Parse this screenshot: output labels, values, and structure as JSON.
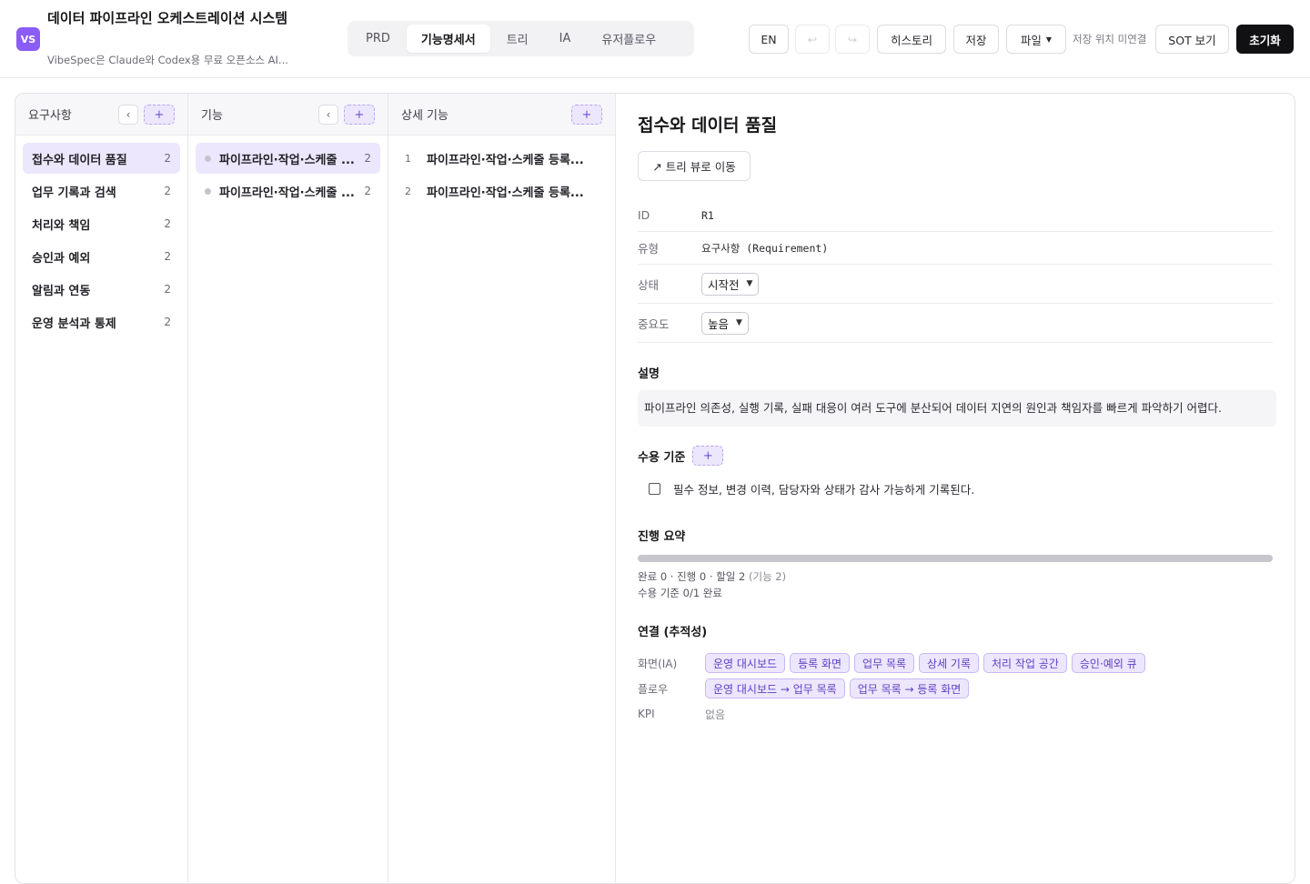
{
  "header": {
    "logo": "VS",
    "title": "데이터 파이프라인 오케스트레이션 시스템",
    "subtitle": "VibeSpec은 Claude와 Codex용 무료 오픈소스 AI...",
    "tabs": [
      "PRD",
      "기능명세서",
      "트리",
      "IA",
      "유저플로우"
    ],
    "active_tab": "기능명세서",
    "lang": "EN",
    "undo_icon": "undo-icon",
    "redo_icon": "redo-icon",
    "history": "히스토리",
    "save": "저장",
    "file": "파일",
    "save_location": "저장 위치 미연결",
    "sot": "SOT 보기",
    "reset": "초기화"
  },
  "columns": {
    "requirements": {
      "title": "요구사항",
      "collapse": "‹",
      "add": "+",
      "items": [
        {
          "label": "접수와 데이터 품질",
          "count": "2"
        },
        {
          "label": "업무 기록과 검색",
          "count": "2"
        },
        {
          "label": "처리와 책임",
          "count": "2"
        },
        {
          "label": "승인과 예외",
          "count": "2"
        },
        {
          "label": "알림과 연동",
          "count": "2"
        },
        {
          "label": "운영 분석과 통제",
          "count": "2"
        }
      ]
    },
    "features": {
      "title": "기능",
      "collapse": "‹",
      "add": "+",
      "items": [
        {
          "label": "파이프라인·작업·스케줄 ...",
          "count": "2"
        },
        {
          "label": "파이프라인·작업·스케줄 ...",
          "count": "2"
        }
      ]
    },
    "details": {
      "title": "상세 기능",
      "add": "+",
      "items": [
        {
          "num": "1",
          "label": "파이프라인·작업·스케줄 등록..."
        },
        {
          "num": "2",
          "label": "파이프라인·작업·스케줄 등록..."
        }
      ]
    }
  },
  "detail": {
    "title": "접수와 데이터 품질",
    "tree_button": "↗ 트리 뷰로 이동",
    "meta": {
      "id_label": "ID",
      "id_value": "R1",
      "type_label": "유형",
      "type_value": "요구사항 (Requirement)",
      "status_label": "상태",
      "status_value": "시작전",
      "priority_label": "중요도",
      "priority_value": "높음"
    },
    "description_title": "설명",
    "description": "파이프라인 의존성, 실행 기록, 실패 대응이 여러 도구에 분산되어 데이터 지연의 원인과 책임자를 빠르게 파악하기 어렵다.",
    "acceptance_title": "수용 기준",
    "acceptance_add": "+",
    "acceptance_items": [
      "필수 정보, 변경 이력, 담당자와 상태가 감사 가능하게 기록된다."
    ],
    "progress_title": "진행 요약",
    "progress_fraction": 0,
    "progress_line1": "완료 0 · 진행 0 · 할일 2",
    "progress_line1_muted": "(기능 2)",
    "progress_line2": "수용 기준 0/1 완료",
    "links_title": "연결 (추적성)",
    "links": {
      "ia_label": "화면(IA)",
      "ia": [
        "운영 대시보드",
        "등록 화면",
        "업무 목록",
        "상세 기록",
        "처리 작업 공간",
        "승인·예외 큐"
      ],
      "flow_label": "플로우",
      "flow": [
        "운영 대시보드 → 업무 목록",
        "업무 목록 → 등록 화면"
      ],
      "kpi_label": "KPI",
      "kpi": "없음"
    }
  }
}
